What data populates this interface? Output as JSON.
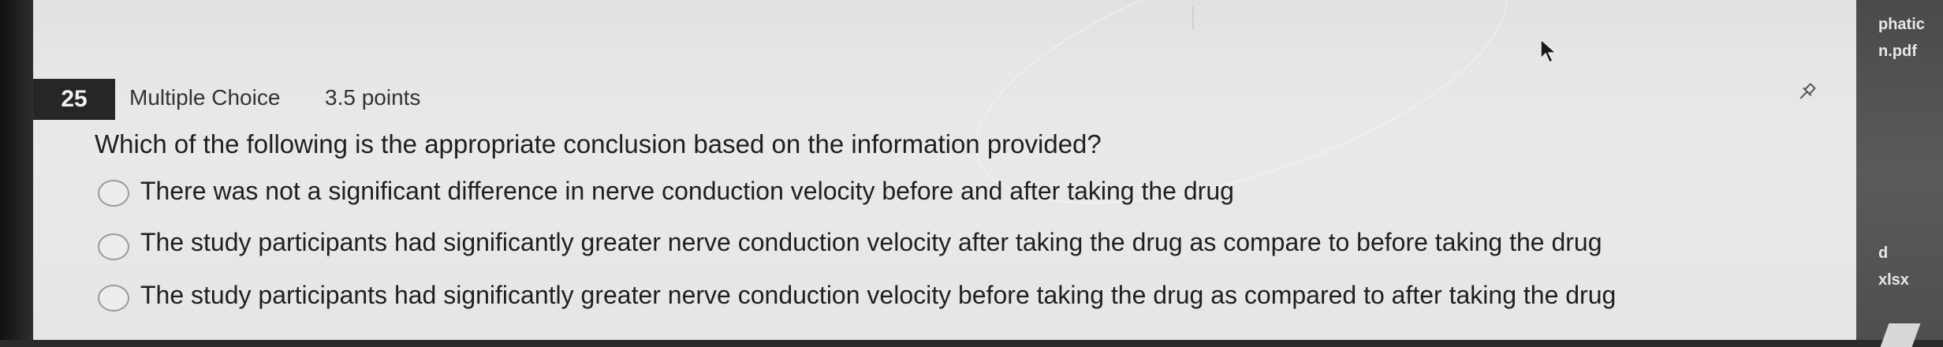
{
  "question": {
    "number": "25",
    "type": "Multiple Choice",
    "points": "3.5 points",
    "text": "Which of the following is the appropriate conclusion based on the information provided?",
    "options": [
      "There was not a significant difference in nerve conduction velocity before and after taking the drug",
      "The study participants had significantly greater nerve conduction velocity after taking the drug as compare to before taking the drug",
      "The study participants had significantly greater nerve conduction velocity before taking the drug as compared to after taking the drug"
    ]
  },
  "side_panel": {
    "file1_line1": "phatic",
    "file1_line2": "n.pdf",
    "file2_line1": "d",
    "file2_line2": "xlsx"
  },
  "icons": {
    "pin": "pin-icon",
    "cursor": "mouse-cursor-icon"
  }
}
